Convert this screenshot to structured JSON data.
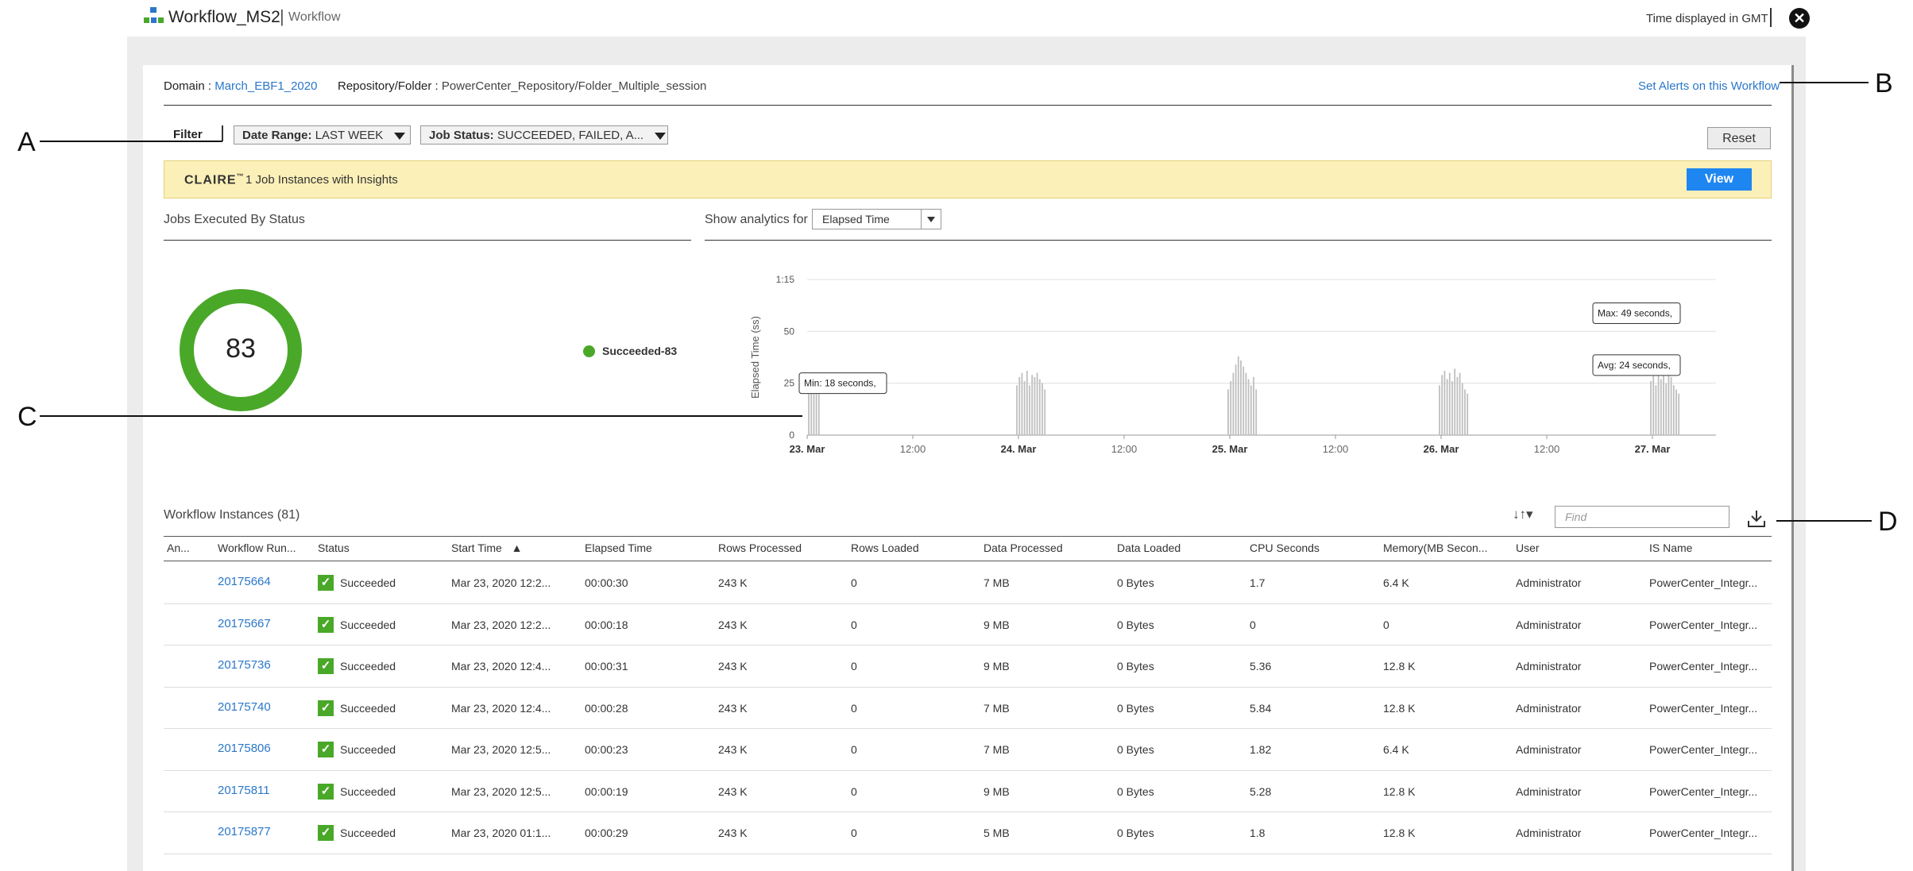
{
  "header": {
    "app_title": "Workflow_MS2",
    "separator": "|",
    "subtitle": "Workflow",
    "timezone_label": "Time displayed in GMT",
    "close_symbol": "✕"
  },
  "info": {
    "domain_label": "Domain :",
    "domain_value": "March_EBF1_2020",
    "repo_label": "Repository/Folder :",
    "repo_value": "PowerCenter_Repository/Folder_Multiple_session",
    "set_alerts": "Set Alerts on this Workflow"
  },
  "filters": {
    "filter_label": "Filter",
    "date_range_key": "Date Range:",
    "date_range_value": "LAST WEEK",
    "job_status_key": "Job Status:",
    "job_status_value": "SUCCEEDED, FAILED, A...",
    "reset": "Reset"
  },
  "claire": {
    "logo": "CLAIRE",
    "logo_mark": "™",
    "message": "1 Job Instances with Insights",
    "view": "View"
  },
  "status_panel": {
    "title": "Jobs Executed By Status",
    "total": "83",
    "legend": "Succeeded-83",
    "success_color": "#4aa829"
  },
  "analytics": {
    "label": "Show analytics for",
    "selected": "Elapsed Time"
  },
  "chart_data": {
    "type": "bar",
    "ylabel": "Elapsed Time (ss)",
    "ytick_labels": [
      "0",
      "25",
      "50",
      "1:15"
    ],
    "ylim": [
      0,
      75
    ],
    "xtick_labels": [
      "23. Mar",
      "12:00",
      "24. Mar",
      "12:00",
      "25. Mar",
      "12:00",
      "26. Mar",
      "12:00",
      "27. Mar"
    ],
    "bold_xticks": [
      "23. Mar",
      "24. Mar",
      "25. Mar",
      "26. Mar",
      "27. Mar"
    ],
    "clusters": [
      {
        "day": 0,
        "values": [
          30,
          24,
          22,
          28,
          20
        ]
      },
      {
        "day": 1,
        "values": [
          24,
          28,
          30,
          26,
          31,
          24,
          29,
          28,
          30,
          27,
          25,
          22
        ]
      },
      {
        "day": 2,
        "values": [
          22,
          26,
          30,
          34,
          38,
          36,
          33,
          30,
          27,
          24,
          28,
          22
        ]
      },
      {
        "day": 3,
        "values": [
          24,
          29,
          31,
          27,
          30,
          26,
          32,
          28,
          30,
          25,
          22,
          20
        ]
      },
      {
        "day": 4,
        "values": [
          26,
          29,
          24,
          31,
          27,
          30,
          25,
          29,
          28,
          24,
          22,
          20
        ]
      }
    ],
    "tooltips": [
      {
        "text": "Min: 18 seconds,",
        "day": 0
      },
      {
        "text": "Max: 49 seconds,",
        "day": 4
      },
      {
        "text": "Avg: 24 seconds,",
        "day": 4
      }
    ],
    "bar_color": "#bfbfbf"
  },
  "table": {
    "title": "Workflow Instances (81)",
    "find_placeholder": "Find",
    "sort_icon": "↓↑▾",
    "columns": [
      "An...",
      "Workflow Run...",
      "Status",
      "Start Time",
      "Elapsed Time",
      "Rows Processed",
      "Rows Loaded",
      "Data Processed",
      "Data Loaded",
      "CPU Seconds",
      "Memory(MB Secon...",
      "User",
      "IS Name"
    ],
    "sort_indicator": "▲",
    "rows": [
      [
        "",
        "20175664",
        "Succeeded",
        "Mar 23, 2020 12:2...",
        "00:00:30",
        "243 K",
        "0",
        "7 MB",
        "0 Bytes",
        "1.7",
        "6.4 K",
        "Administrator",
        "PowerCenter_Integr..."
      ],
      [
        "",
        "20175667",
        "Succeeded",
        "Mar 23, 2020 12:2...",
        "00:00:18",
        "243 K",
        "0",
        "9 MB",
        "0 Bytes",
        "0",
        "0",
        "Administrator",
        "PowerCenter_Integr..."
      ],
      [
        "",
        "20175736",
        "Succeeded",
        "Mar 23, 2020 12:4...",
        "00:00:31",
        "243 K",
        "0",
        "9 MB",
        "0 Bytes",
        "5.36",
        "12.8 K",
        "Administrator",
        "PowerCenter_Integr..."
      ],
      [
        "",
        "20175740",
        "Succeeded",
        "Mar 23, 2020 12:4...",
        "00:00:28",
        "243 K",
        "0",
        "7 MB",
        "0 Bytes",
        "5.84",
        "12.8 K",
        "Administrator",
        "PowerCenter_Integr..."
      ],
      [
        "",
        "20175806",
        "Succeeded",
        "Mar 23, 2020 12:5...",
        "00:00:23",
        "243 K",
        "0",
        "7 MB",
        "0 Bytes",
        "1.82",
        "6.4 K",
        "Administrator",
        "PowerCenter_Integr..."
      ],
      [
        "",
        "20175811",
        "Succeeded",
        "Mar 23, 2020 12:5...",
        "00:00:19",
        "243 K",
        "0",
        "9 MB",
        "0 Bytes",
        "5.28",
        "12.8 K",
        "Administrator",
        "PowerCenter_Integr..."
      ],
      [
        "",
        "20175877",
        "Succeeded",
        "Mar 23, 2020 01:1...",
        "00:00:29",
        "243 K",
        "0",
        "5 MB",
        "0 Bytes",
        "1.8",
        "12.8 K",
        "Administrator",
        "PowerCenter_Integr..."
      ]
    ]
  },
  "annotations": {
    "a": "A",
    "b": "B",
    "c": "C",
    "d": "D"
  }
}
